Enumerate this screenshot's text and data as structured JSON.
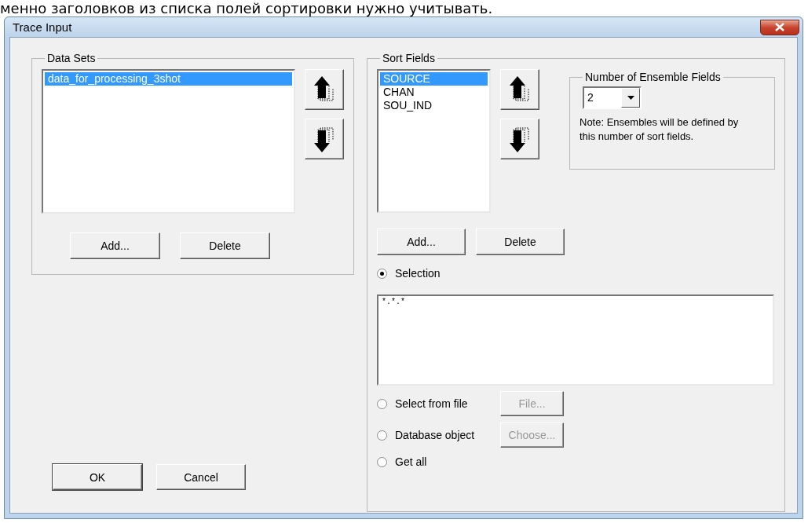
{
  "caption": "менно заголовков из списка полей сортировки нужно учитывать.",
  "window": {
    "title": "Trace Input"
  },
  "data_sets": {
    "label": "Data Sets",
    "items": [
      {
        "label": "data_for_processing_3shot",
        "selected": true
      }
    ],
    "buttons": [
      "Add...",
      "Delete"
    ]
  },
  "sort_fields": {
    "label": "Sort Fields",
    "items": [
      {
        "label": "SOURCE",
        "selected": true
      },
      {
        "label": "CHAN",
        "selected": false
      },
      {
        "label": "SOU_IND",
        "selected": false
      }
    ],
    "buttons": [
      "Add...",
      "Delete"
    ]
  },
  "ensemble": {
    "label": "Number of Ensemble Fields",
    "value": "2",
    "note": "Note: Ensembles will be defined by this number of sort fields."
  },
  "options": [
    {
      "kind": "text",
      "label": "Selection",
      "selected": true,
      "value": "*.*.*"
    },
    {
      "kind": "button",
      "label": "Select from file",
      "selected": false,
      "button": "File...",
      "disabled": true
    },
    {
      "kind": "button",
      "label": "Database object",
      "selected": false,
      "button": "Choose...",
      "disabled": true
    },
    {
      "kind": "plain",
      "label": "Get all",
      "selected": false
    }
  ],
  "footer_buttons": [
    "OK",
    "Cancel"
  ]
}
